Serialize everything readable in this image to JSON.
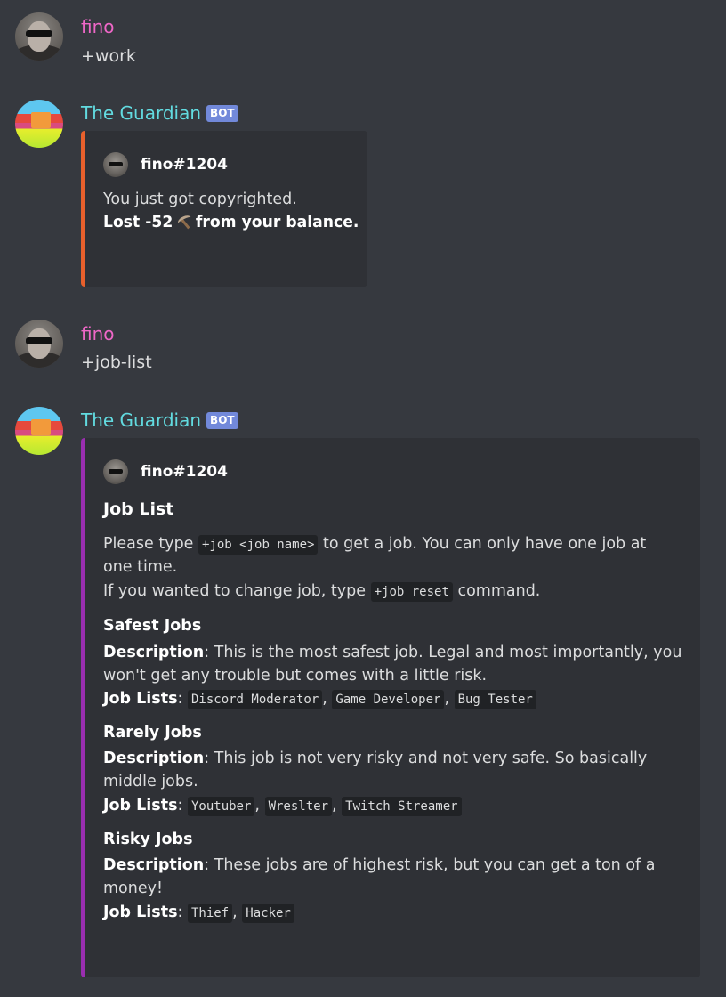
{
  "messages": [
    {
      "author": "fino",
      "text": "+work"
    },
    {
      "author": "The Guardian",
      "bot_tag": "BOT",
      "embed": {
        "author_name": "fino#1204",
        "line1": "You just got copyrighted.",
        "line2_prefix": "Lost -52",
        "line2_suffix": "from your balance.",
        "currency_icon": "pickaxe-icon",
        "accent_color": "#e8602c"
      }
    },
    {
      "author": "fino",
      "text": "+job-list"
    },
    {
      "author": "The Guardian",
      "bot_tag": "BOT",
      "embed": {
        "author_name": "fino#1204",
        "accent_color": "#9a2eb0",
        "title": "Job List",
        "desc": {
          "l1_a": "Please type ",
          "l1_code": "+job <job name>",
          "l1_b": " to get a job. You can only have one job at",
          "l2": "one time.",
          "l3_a": "If you wanted to change job, type ",
          "l3_code": "+job reset",
          "l3_b": " command."
        },
        "fields": [
          {
            "name": "Safest Jobs",
            "desc_label": "Description",
            "desc_1": ": This is the most safest job. Legal and most importantly, you",
            "desc_2": "won't get any trouble but comes with a little risk.",
            "jobs_label": "Job Lists",
            "jobs": [
              "Discord Moderator",
              "Game Developer",
              "Bug Tester"
            ]
          },
          {
            "name": "Rarely Jobs",
            "desc_label": "Description",
            "desc_1": ": This job is not very risky and not very safe. So basically",
            "desc_2": "middle jobs.",
            "jobs_label": "Job Lists",
            "jobs": [
              "Youtuber",
              "Wreslter",
              "Twitch Streamer"
            ]
          },
          {
            "name": "Risky Jobs",
            "desc_label": "Description",
            "desc_1": ": These jobs are of highest risk, but you can get a ton of a",
            "desc_2": "money!",
            "jobs_label": "Job Lists",
            "jobs": [
              "Thief",
              "Hacker"
            ]
          }
        ]
      }
    }
  ],
  "separators": {
    "colon": ": ",
    "comma": ", "
  }
}
